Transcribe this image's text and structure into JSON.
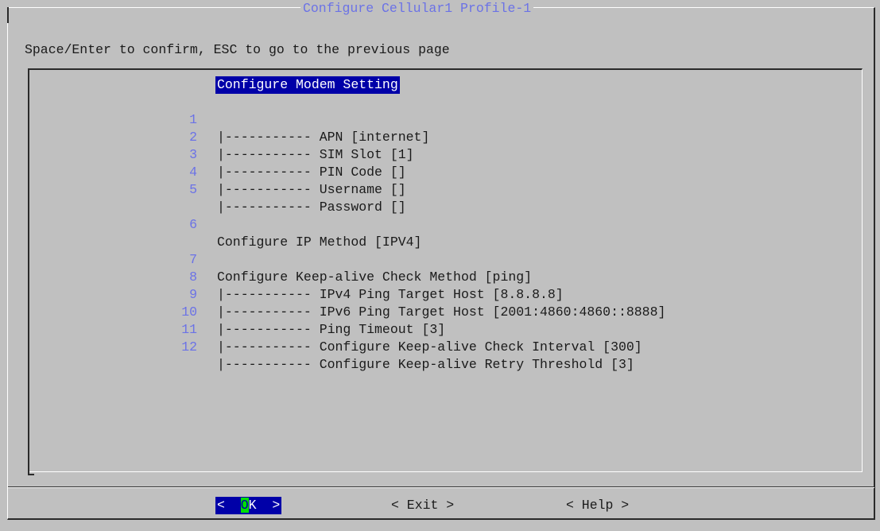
{
  "dialog": {
    "title": "Configure Cellular1 Profile-1",
    "instruction": "Space/Enter to confirm, ESC to go to the previous page"
  },
  "menu": {
    "header": "Configure Modem Setting",
    "items": [
      {
        "num": "1",
        "label": "|----------- APN [internet]"
      },
      {
        "num": "2",
        "label": "|----------- SIM Slot [1]"
      },
      {
        "num": "3",
        "label": "|----------- PIN Code []"
      },
      {
        "num": "4",
        "label": "|----------- Username []"
      },
      {
        "num": "5",
        "label": "|----------- Password []"
      },
      {
        "num": "6",
        "label": "Configure IP Method [IPV4]"
      },
      {
        "num": "7",
        "label": "Configure Keep-alive Check Method [ping]"
      },
      {
        "num": "8",
        "label": "|----------- IPv4 Ping Target Host [8.8.8.8]"
      },
      {
        "num": "9",
        "label": "|----------- IPv6 Ping Target Host [2001:4860:4860::8888]"
      },
      {
        "num": "10",
        "label": "|----------- Ping Timeout [3]"
      },
      {
        "num": "11",
        "label": "|----------- Configure Keep-alive Check Interval [300]"
      },
      {
        "num": "12",
        "label": "|----------- Configure Keep-alive Retry Threshold [3]"
      }
    ]
  },
  "buttons": {
    "ok": {
      "pre": "<  ",
      "hotkey": "O",
      "post": "K  >"
    },
    "exit": "< Exit >",
    "help": "< Help >"
  },
  "colors": {
    "background": "#c0c0c0",
    "highlight": "#0000a8",
    "hotkey": "#00e000",
    "number": "#6b72e6"
  }
}
